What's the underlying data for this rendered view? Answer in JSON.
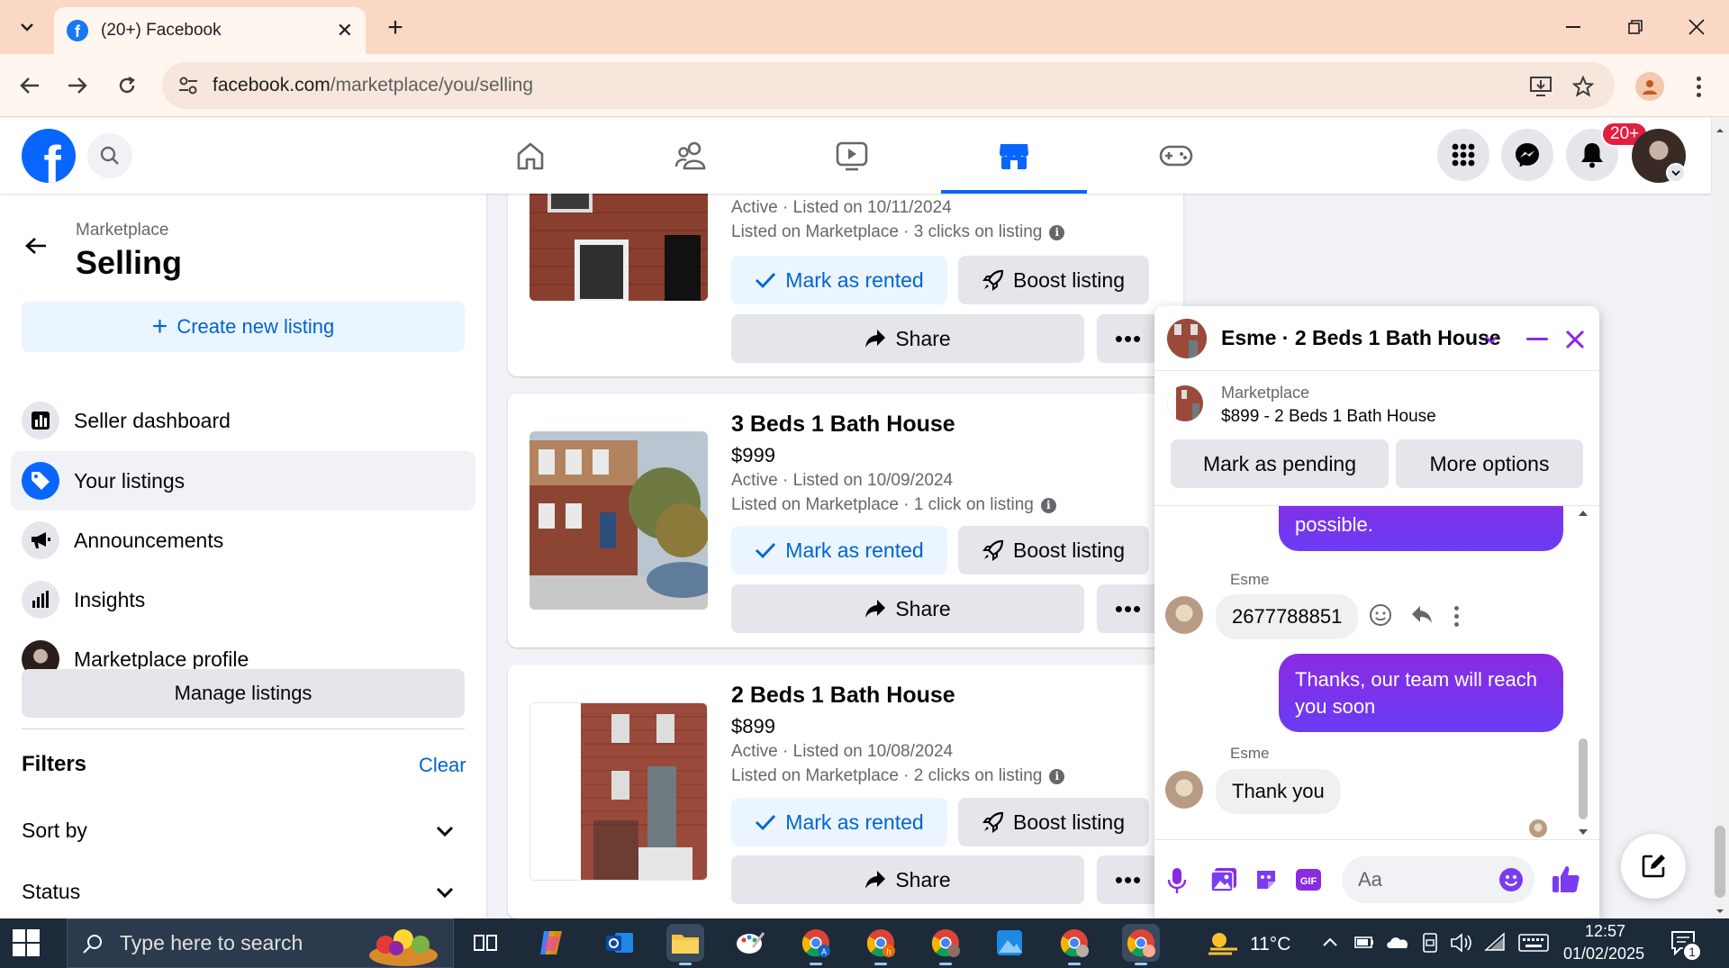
{
  "browser": {
    "tab_title": "(20+) Facebook",
    "url_host": "facebook.com",
    "url_path": "/marketplace/you/selling"
  },
  "header": {
    "notification_badge": "20+"
  },
  "sidebar": {
    "breadcrumb": "Marketplace",
    "title": "Selling",
    "create_label": "Create new listing",
    "items": [
      {
        "label": "Seller dashboard",
        "icon": "dashboard-icon"
      },
      {
        "label": "Your listings",
        "icon": "tag-icon"
      },
      {
        "label": "Announcements",
        "icon": "megaphone-icon"
      },
      {
        "label": "Insights",
        "icon": "bar-chart-icon"
      },
      {
        "label": "Marketplace profile",
        "icon": "profile-avatar"
      }
    ],
    "manage_label": "Manage listings",
    "filters_label": "Filters",
    "clear_label": "Clear",
    "sort_label": "Sort by",
    "status_label": "Status"
  },
  "listings": [
    {
      "title": "",
      "price": "",
      "status": "Active · Listed on 10/11/2024",
      "stats": "Listed on Marketplace · 3 clicks on listing",
      "mark_label": "Mark as rented",
      "boost_label": "Boost listing",
      "share_label": "Share"
    },
    {
      "title": "3 Beds 1 Bath House",
      "price": "$999",
      "status": "Active · Listed on 10/09/2024",
      "stats": "Listed on Marketplace · 1 click on listing",
      "mark_label": "Mark as rented",
      "boost_label": "Boost listing",
      "share_label": "Share"
    },
    {
      "title": "2 Beds 1 Bath House",
      "price": "$899",
      "status": "Active · Listed on 10/08/2024",
      "stats": "Listed on Marketplace · 2 clicks on listing",
      "mark_label": "Mark as rented",
      "boost_label": "Boost listing",
      "share_label": "Share"
    }
  ],
  "chat": {
    "title": "Esme · 2 Beds 1 Bath House",
    "context_label": "Marketplace",
    "context_item": "$899 - 2 Beds 1 Bath House",
    "pending_label": "Mark as pending",
    "more_label": "More options",
    "messages": [
      {
        "from": "me",
        "text": "possible."
      },
      {
        "from": "Esme",
        "text": "2677788851"
      },
      {
        "from": "me",
        "text": "Thanks, our team will reach you soon"
      },
      {
        "from": "Esme",
        "text": "Thank you"
      }
    ],
    "sender_name": "Esme",
    "input_placeholder": "Aa"
  },
  "taskbar": {
    "search_placeholder": "Type here to search",
    "temperature": "11°C",
    "time": "12:57",
    "date": "01/02/2025",
    "notification_count": "1"
  },
  "colors": {
    "fb_blue": "#0866ff",
    "link_blue": "#0064d1",
    "chrome_tab_bg": "#fbd8c5",
    "messenger_gradient_top": "#8a2be2",
    "messenger_gradient_bottom": "#6a3cf5"
  }
}
